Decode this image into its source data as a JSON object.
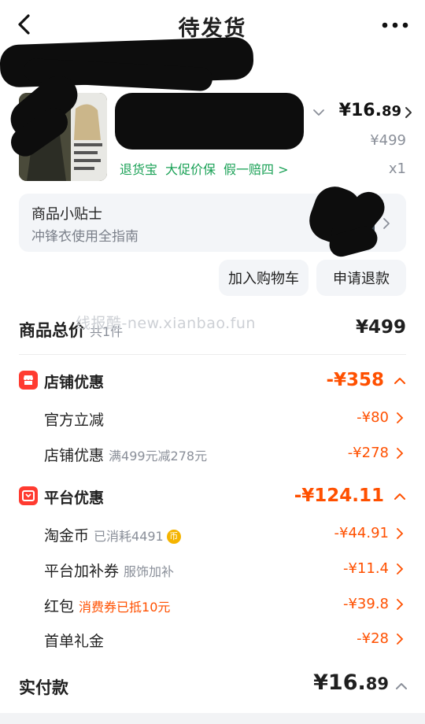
{
  "header": {
    "title": "待发货"
  },
  "product": {
    "price_symbol_int": "¥16.",
    "price_decimal": "89",
    "original_price": "¥499",
    "quantity": "x1",
    "tags": [
      "退货宝",
      "大促价保",
      "假一赔四"
    ],
    "tag_arrow": ">"
  },
  "tips": {
    "title": "商品小贴士",
    "subtitle": "冲锋衣使用全指南"
  },
  "actions": {
    "add_cart": "加入购物车",
    "refund": "申请退款"
  },
  "summary": {
    "total_label": "商品总价",
    "total_count": "共1件",
    "total_value": "¥499",
    "watermark": "线报酷-new.xianbao.fun"
  },
  "store_discount": {
    "title": "店铺优惠",
    "value": "-¥358",
    "items": [
      {
        "label": "官方立减",
        "note": "",
        "value": "-¥80"
      },
      {
        "label": "店铺优惠",
        "note": "满499元减278元",
        "value": "-¥278"
      }
    ]
  },
  "platform_discount": {
    "title": "平台优惠",
    "value": "-¥124.11",
    "items": [
      {
        "label": "淘金币",
        "note": "已消耗4491",
        "coin": "币",
        "value": "-¥44.91"
      },
      {
        "label": "平台加补券",
        "note": "服饰加补",
        "value": "-¥11.4"
      },
      {
        "label": "红包",
        "note": "消费券已抵10元",
        "value": "-¥39.8"
      },
      {
        "label": "首单礼金",
        "note": "",
        "value": "-¥28"
      }
    ]
  },
  "payment": {
    "label": "实付款",
    "value_int": "¥16.",
    "value_decimal": "89"
  },
  "colors": {
    "accent_orange": "#ff5000",
    "green_tag": "#1aa156",
    "section_icon_red": "#ff3b30"
  }
}
